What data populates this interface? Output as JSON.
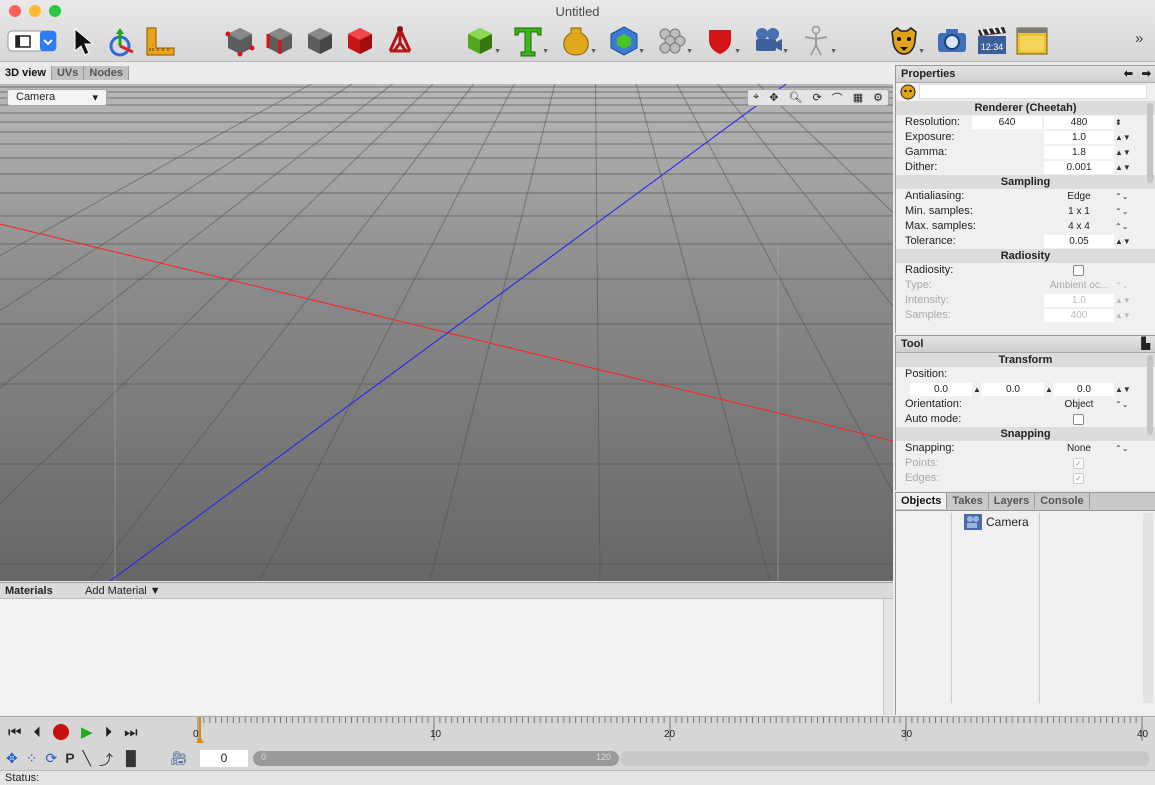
{
  "window": {
    "title": "Untitled"
  },
  "toolbar": {
    "icons": [
      "view-mode-icon",
      "arrow-select-icon",
      "move-scale-tool-icon",
      "ruler-icon",
      "cube-vertex-icon",
      "cube-edge-icon",
      "cube-face-icon",
      "cube-object-icon",
      "skeleton-icon",
      "primitive-cube-icon",
      "text-tool-icon",
      "lathe-tool-icon",
      "array-icon",
      "subdivide-icon",
      "bevel-shield-icon",
      "camera-object-icon",
      "figure-icon",
      "cheetah-render-icon",
      "photo-camera-icon",
      "clapper-icon",
      "window-icon"
    ],
    "clapper_time": "12:34",
    "overflow": "»"
  },
  "view_tabs": [
    "3D view",
    "UVs",
    "Nodes"
  ],
  "viewport": {
    "camera_select": "Camera",
    "axis_colors": {
      "x": "#ff1f1f",
      "z": "#1f1fff"
    }
  },
  "materials": {
    "title": "Materials",
    "add_label": "Add Material ▼"
  },
  "properties": {
    "title": "Properties",
    "renderer_title": "Renderer (Cheetah)",
    "resolution_label": "Resolution:",
    "resolution_w": "640",
    "resolution_h": "480",
    "exposure_label": "Exposure:",
    "exposure": "1.0",
    "gamma_label": "Gamma:",
    "gamma": "1.8",
    "dither_label": "Dither:",
    "dither": "0.001",
    "sampling_title": "Sampling",
    "antialiasing_label": "Antialiasing:",
    "antialiasing": "Edge",
    "min_samples_label": "Min. samples:",
    "min_samples": "1 x 1",
    "max_samples_label": "Max. samples:",
    "max_samples": "4 x 4",
    "tolerance_label": "Tolerance:",
    "tolerance": "0.05",
    "radiosity_title": "Radiosity",
    "radiosity_label": "Radiosity:",
    "type_label": "Type:",
    "type": "Ambient oc...",
    "intensity_label": "Intensity:",
    "intensity": "1.0",
    "samples_label": "Samples:",
    "samples": "400"
  },
  "tool": {
    "title": "Tool",
    "transform_title": "Transform",
    "position_label": "Position:",
    "pos_x": "0.0",
    "pos_y": "0.0",
    "pos_z": "0.0",
    "orientation_label": "Orientation:",
    "orientation": "Object",
    "auto_mode_label": "Auto mode:",
    "snapping_title": "Snapping",
    "snapping_label": "Snapping:",
    "snapping": "None",
    "points_label": "Points:",
    "edges_label": "Edges:"
  },
  "objects": {
    "tabs": [
      "Objects",
      "Takes",
      "Layers",
      "Console"
    ],
    "items": [
      {
        "name": "Camera"
      }
    ]
  },
  "timeline": {
    "ticks": [
      "0",
      "10",
      "20",
      "30",
      "40"
    ],
    "current_frame": "0",
    "range_start": "0",
    "range_end": "120"
  },
  "status": {
    "label": "Status:"
  }
}
